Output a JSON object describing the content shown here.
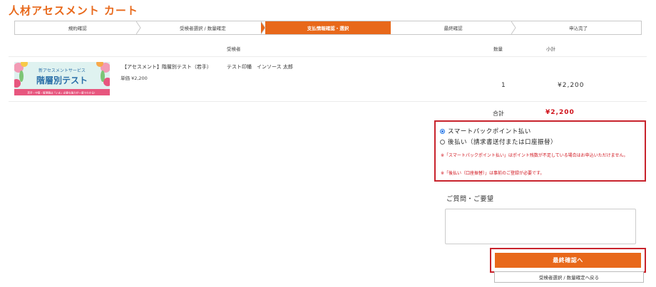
{
  "page": {
    "title": "人材アセスメント カート"
  },
  "steps": [
    {
      "label": "規約確認"
    },
    {
      "label": "受検者選択 / 数量確定"
    },
    {
      "label": "支払情報確認・選択",
      "active": true
    },
    {
      "label": "最終確認"
    },
    {
      "label": "申込完了"
    }
  ],
  "table": {
    "col_examinee": "受検者",
    "col_qty": "数量",
    "col_subtotal": "小計"
  },
  "item": {
    "banner_line1": "新アセスメントサービス",
    "banner_line2": "階層別テスト",
    "banner_line3": "若手・中堅・管理職は「いま」必要な能力が一度でわかる！",
    "name": "【アセスメント】階層別テスト（若手）",
    "unit_price": "単価 ¥2,200",
    "examinee": "テスト印幡　インソース 太郎",
    "qty": "1",
    "subtotal": "¥2,200"
  },
  "total": {
    "label": "合計",
    "value": "¥2,200"
  },
  "payment": {
    "option1": "スマートパックポイント払い",
    "option2": "後払い（請求書送付または口座振替）",
    "note1": "※「スマートパックポイント払い」はポイント残数が不足している場合はお申込いただけません。",
    "note2": "※「後払い（口座振替）」は事前のご登録が必要です。",
    "selected": "option1"
  },
  "question": {
    "label": "ご質問・ご要望",
    "value": ""
  },
  "buttons": {
    "final": "最終確認へ",
    "back": "受検者選択 / 数量確定へ戻る"
  },
  "colors": {
    "accent": "#e8681a",
    "highlight": "#c8232c",
    "price": "#d0121b"
  }
}
